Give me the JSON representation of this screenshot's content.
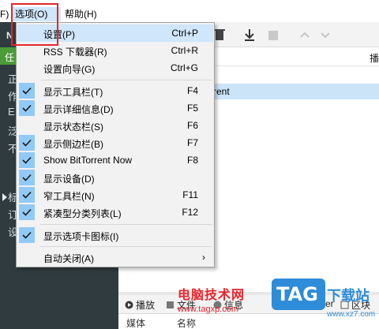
{
  "menubar": {
    "file": "F)",
    "options": "选项(O)",
    "help": "帮助(H)"
  },
  "sidebar": {
    "top_label": "N",
    "selected": "任",
    "chars": [
      "正",
      "作",
      "E",
      "泛",
      "不",
      "标",
      "订",
      "设"
    ]
  },
  "main": {
    "column_header": "播",
    "selected_row": "rent"
  },
  "bottom": {
    "tabs": [
      {
        "label": "播放",
        "icon": "play-icon"
      },
      {
        "label": "文件",
        "icon": "file-icon"
      },
      {
        "label": "信息",
        "icon": "info-icon"
      },
      {
        "label": "er",
        "icon": "peer-icon"
      },
      {
        "label": "区块",
        "icon": "block-icon"
      }
    ],
    "head_left": "媒体",
    "head_right": "名称"
  },
  "options_menu": {
    "check_icon": "checkmark-icon",
    "check_color": "#91c9f7",
    "hover_color": "#cfe6fb",
    "items": [
      {
        "label": "设置(P)",
        "shortcut": "Ctrl+P",
        "checked": false
      },
      {
        "label": "RSS 下载器(R)",
        "shortcut": "Ctrl+R",
        "checked": false
      },
      {
        "label": "设置向导(G)",
        "shortcut": "Ctrl+G",
        "checked": false
      },
      {
        "label": "显示工具栏(T)",
        "shortcut": "F4",
        "checked": true
      },
      {
        "label": "显示详细信息(D)",
        "shortcut": "F5",
        "checked": true
      },
      {
        "label": "显示状态栏(S)",
        "shortcut": "F6",
        "checked": false
      },
      {
        "label": "显示侧边栏(B)",
        "shortcut": "F7",
        "checked": true
      },
      {
        "label": "Show BitTorrent Now",
        "shortcut": "F8",
        "checked": true
      },
      {
        "label": "显示设备(D)",
        "shortcut": "",
        "checked": true
      },
      {
        "label": "窄工具栏(N)",
        "shortcut": "F11",
        "checked": true
      },
      {
        "label": "紧凑型分类列表(L)",
        "shortcut": "F12",
        "checked": true
      },
      {
        "label": "显示选项卡图标(I)",
        "shortcut": "",
        "checked": true
      },
      {
        "label": "自动关闭(A)",
        "shortcut": "",
        "checked": false,
        "submenu": true
      }
    ]
  },
  "watermark": {
    "title": "电脑技术网",
    "url": "www.tagxp.com",
    "badge": "TAG",
    "site": "下载站",
    "site_url": "www.xz7.com"
  },
  "colors": {
    "highlight_border": "#e3262e",
    "sidebar_bg": "#2f3b3f",
    "sidebar_selected": "#4b9b38"
  }
}
